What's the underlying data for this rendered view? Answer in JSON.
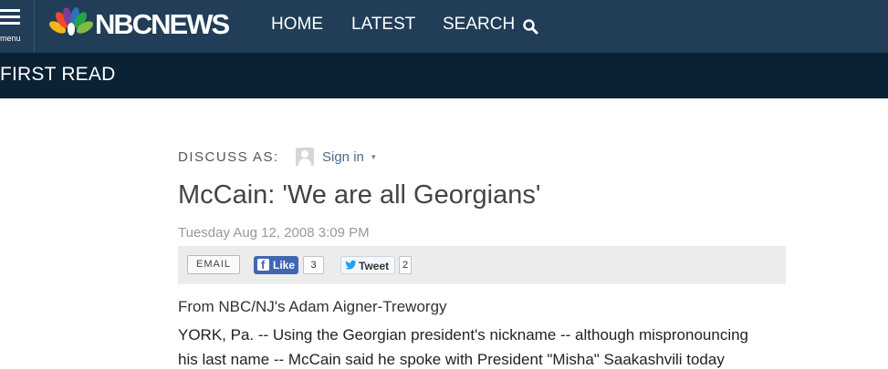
{
  "nav": {
    "menu_label": "menu",
    "logo_text": "NBCNEWS",
    "items": [
      {
        "label": "HOME"
      },
      {
        "label": "LATEST"
      },
      {
        "label": "SEARCH"
      }
    ]
  },
  "section": {
    "title": "FIRST READ"
  },
  "discuss": {
    "label": "DISCUSS AS:",
    "signin_label": "Sign in",
    "caret": "▾"
  },
  "article": {
    "headline": "McCain: 'We are all Georgians'",
    "date": "Tuesday Aug 12, 2008 3:09 PM",
    "byline": "From NBC/NJ's Adam Aigner-Treworgy",
    "body_lines": [
      "YORK, Pa. -- Using the Georgian president's nickname -- although mispronouncing",
      "his last name -- McCain said he spoke with President \"Misha\" Saakashvili today"
    ]
  },
  "share": {
    "email_label": "EMAIL",
    "like_label": "Like",
    "like_count": "3",
    "tweet_label": "Tweet",
    "tweet_count": "2"
  },
  "colors": {
    "nav_bg": "#213d57",
    "section_bg": "#0b2134",
    "facebook": "#4267b2",
    "twitter": "#1da1f2"
  }
}
